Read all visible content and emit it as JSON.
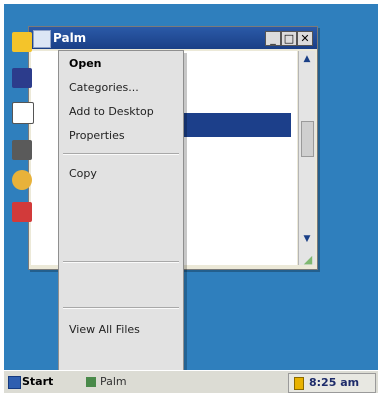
{
  "window": {
    "title": "Palm",
    "buttons": {
      "minimize": "_",
      "maximize": "□",
      "close": "✕"
    },
    "scroll": {
      "up": "▲",
      "down": "▼"
    }
  },
  "context_menu": {
    "items": [
      {
        "label": "Open",
        "state": "default"
      },
      {
        "label": "Categories...",
        "state": "enabled"
      },
      {
        "label": "Add to Desktop",
        "state": "enabled"
      },
      {
        "label": "Properties",
        "state": "enabled"
      },
      {
        "label": "Copy",
        "state": "enabled"
      },
      {
        "label": "View All Files",
        "state": "enabled"
      }
    ]
  },
  "taskbar": {
    "start_label": "Start",
    "task_label": "Palm",
    "clock": "8:25 am"
  },
  "colors": {
    "desktop": "#2f7fbd",
    "titlebar": "#1a3f86",
    "selection": "#1c3f8a",
    "menu_bg": "#e2e2e2"
  }
}
